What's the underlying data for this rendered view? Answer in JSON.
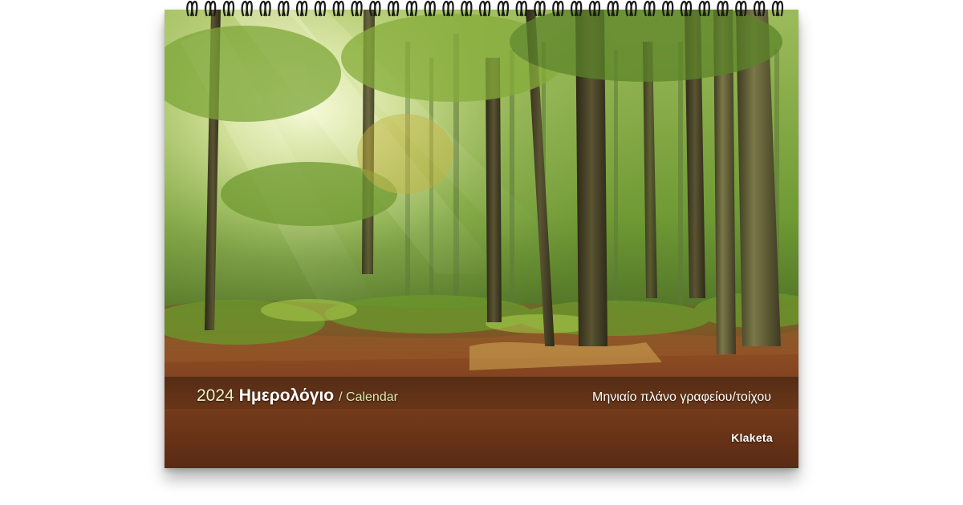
{
  "calendar": {
    "year": "2024",
    "title": "Ημερολόγιο",
    "title_suffix": "/ Calendar",
    "subtitle": "Μηνιαίο πλάνο γραφείου/τοίχου",
    "brand": "Klaketa"
  },
  "photo": {
    "subject": "forest-photo",
    "colors": {
      "canopy_light": "#e8f0b0",
      "foliage": "#5f8a2a",
      "deep_green": "#2e4a1c",
      "trunk": "#3b3522",
      "forest_floor": "#7a3e1c",
      "leaf_litter": "#b4652c"
    }
  },
  "binding": {
    "type": "wire-spiral",
    "color": "#1a1a1a"
  }
}
